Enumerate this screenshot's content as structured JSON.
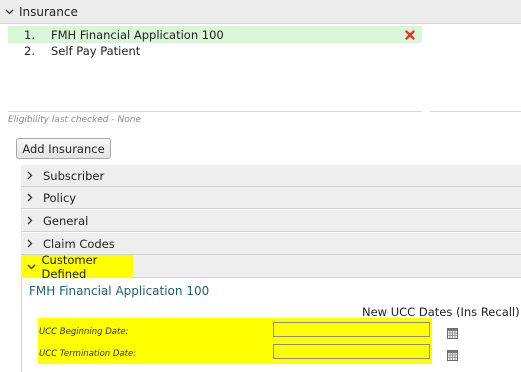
{
  "header": {
    "title": "Insurance"
  },
  "insurance_list": [
    {
      "number": "1.",
      "name": "FMH Financial Application 100",
      "selected": true
    },
    {
      "number": "2.",
      "name": "Self Pay Patient",
      "selected": false
    }
  ],
  "eligibility_text": "Eligibility last checked - None",
  "add_insurance_label": "Add Insurance",
  "sections": [
    {
      "label": "Subscriber",
      "expanded": false
    },
    {
      "label": "Policy",
      "expanded": false
    },
    {
      "label": "General",
      "expanded": false
    },
    {
      "label": "Claim Codes",
      "expanded": false
    },
    {
      "label": "Customer Defined",
      "expanded": true
    }
  ],
  "customer_defined": {
    "plan_title": "FMH Financial Application 100",
    "group_heading": "New UCC Dates (Ins Recall)",
    "fields": [
      {
        "label": "UCC Beginning Date:",
        "value": ""
      },
      {
        "label": "UCC Termination Date:",
        "value": ""
      }
    ]
  },
  "colors": {
    "highlight": "#ffff00",
    "selected_row": "#daf6d9",
    "remove_icon": "#e2372b",
    "section_bg": "#eeeeee",
    "title_teal": "#1f5f74"
  },
  "icons": [
    "chevron-down-icon",
    "chevron-right-icon",
    "remove-x-icon",
    "calendar-icon"
  ]
}
